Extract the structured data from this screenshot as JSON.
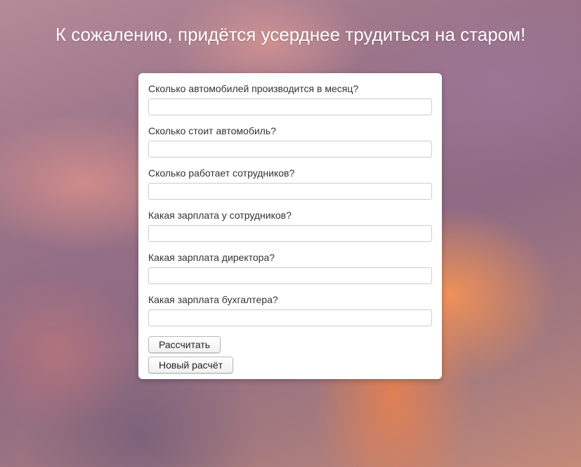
{
  "page": {
    "heading": "К сожалению, придётся усерднее трудиться на старом!"
  },
  "form": {
    "fields": [
      {
        "label": "Сколько автомобилей производится в месяц?",
        "value": "",
        "placeholder": ""
      },
      {
        "label": "Сколько стоит автомобиль?",
        "value": "",
        "placeholder": ""
      },
      {
        "label": "Сколько работает сотрудников?",
        "value": "",
        "placeholder": ""
      },
      {
        "label": "Какая зарплата у сотрудников?",
        "value": "",
        "placeholder": ""
      },
      {
        "label": "Какая зарплата директора?",
        "value": "",
        "placeholder": ""
      },
      {
        "label": "Какая зарплата бухгалтера?",
        "value": "",
        "placeholder": ""
      }
    ],
    "calculate_label": "Рассчитать",
    "new_calc_label": "Новый расчёт"
  },
  "colors": {
    "card_background": "#ffffff",
    "heading_text": "#ffffff",
    "label_text": "#333333"
  }
}
